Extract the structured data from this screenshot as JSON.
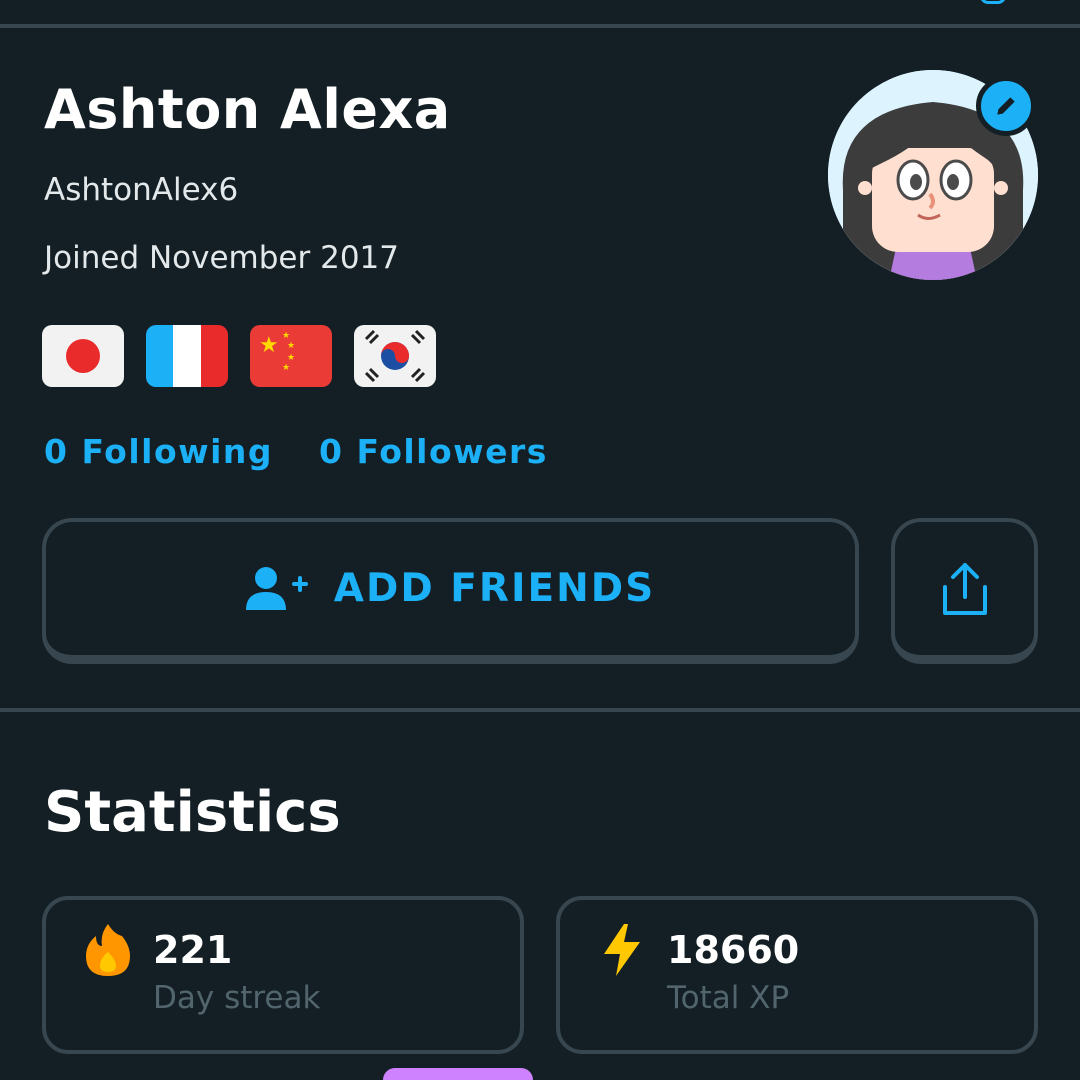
{
  "profile": {
    "display_name": "Ashton Alexa",
    "username": "AshtonAlex6",
    "joined": "Joined November 2017",
    "courses": [
      {
        "language": "Japanese",
        "flag_icon": "japan-flag-icon"
      },
      {
        "language": "French",
        "flag_icon": "france-flag-icon"
      },
      {
        "language": "Chinese",
        "flag_icon": "china-flag-icon"
      },
      {
        "language": "Korean",
        "flag_icon": "south-korea-flag-icon"
      }
    ],
    "following_label": "0 Following",
    "followers_label": "0 Followers"
  },
  "actions": {
    "add_friends_label": "ADD FRIENDS",
    "add_friends_icon": "add-person-icon",
    "share_icon": "share-icon",
    "edit_avatar_icon": "pencil-icon"
  },
  "statistics": {
    "title": "Statistics",
    "cards": [
      {
        "value": "221",
        "label": "Day streak",
        "icon": "fire-icon"
      },
      {
        "value": "18660",
        "label": "Total XP",
        "icon": "lightning-icon"
      }
    ]
  },
  "colors": {
    "background": "#131f24",
    "accent": "#1cb0f6",
    "border": "#37464f",
    "muted_text": "#52656d",
    "streak": "#ff9600",
    "xp": "#ffc800"
  }
}
